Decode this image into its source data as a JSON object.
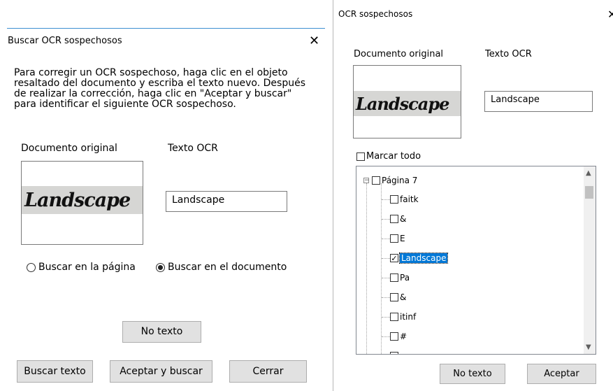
{
  "dialog_left": {
    "title": "Buscar OCR sospechosos",
    "close_glyph": "✕",
    "instructions": "Para corregir un OCR sospechoso, haga clic en el objeto resaltado del documento y escriba el texto nuevo. Después de realizar la corrección, haga clic en \"Aceptar y buscar\" para identificar el siguiente OCR sospechoso.",
    "original_label": "Documento original",
    "ocr_label": "Texto OCR",
    "image_word": "Landscape",
    "ocr_value": "Landscape",
    "radio_page": "Buscar en la página",
    "radio_document": "Buscar en el documento",
    "radio_selected": "document",
    "no_text_button": "No texto",
    "search_text_button": "Buscar texto",
    "accept_search_button": "Aceptar y buscar",
    "close_button": "Cerrar"
  },
  "dialog_right": {
    "title": "OCR sospechosos",
    "close_glyph": "✕",
    "original_label": "Documento original",
    "ocr_label": "Texto OCR",
    "image_word": "Landscape",
    "ocr_value": "Landscape",
    "mark_all": "Marcar todo",
    "tree": {
      "root": "Página 7",
      "items": [
        {
          "label": "faitk",
          "checked": false
        },
        {
          "label": "&",
          "checked": false
        },
        {
          "label": "E",
          "checked": false
        },
        {
          "label": "Landscape",
          "checked": true,
          "selected": true
        },
        {
          "label": "Pa",
          "checked": false
        },
        {
          "label": "&",
          "checked": false
        },
        {
          "label": "itinf",
          "checked": false
        },
        {
          "label": "#",
          "checked": false
        },
        {
          "label": "",
          "checked": false
        }
      ]
    },
    "no_text_button": "No texto",
    "accept_button": "Aceptar"
  },
  "colors": {
    "selection": "#0078d7",
    "title_line": "#3c8fd1",
    "button_face": "#e1e1e1"
  }
}
